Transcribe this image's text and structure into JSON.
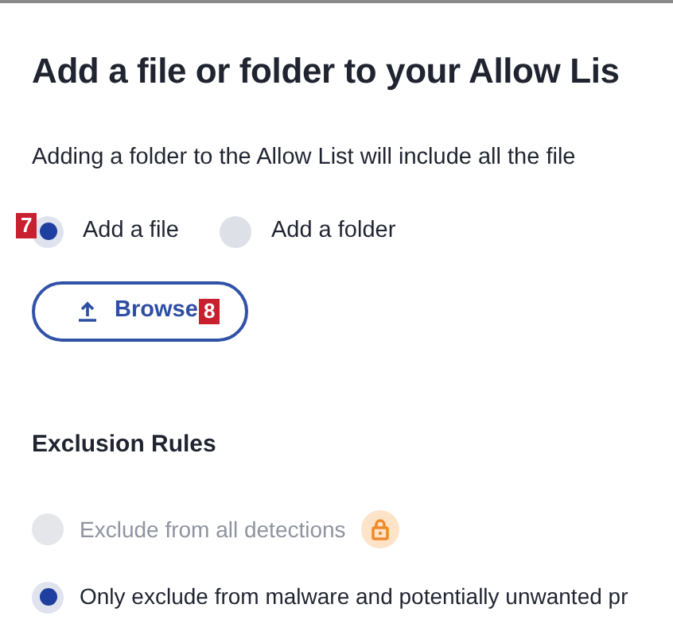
{
  "title": "Add a file or folder to your Allow Lis",
  "description": "Adding a folder to the Allow List will include all the file",
  "item_type": [
    {
      "label": "Add a file",
      "selected": true,
      "callout": "7"
    },
    {
      "label": "Add a folder",
      "selected": false
    }
  ],
  "browse_button": {
    "label": "Browse",
    "callout": "8"
  },
  "exclusion_rules": {
    "heading": "Exclusion Rules",
    "options": [
      {
        "label": "Exclude from all detections",
        "selected": false,
        "disabled": true,
        "locked": true
      },
      {
        "label": "Only exclude from malware and potentially unwanted pr",
        "selected": true,
        "disabled": false,
        "locked": false
      }
    ]
  }
}
